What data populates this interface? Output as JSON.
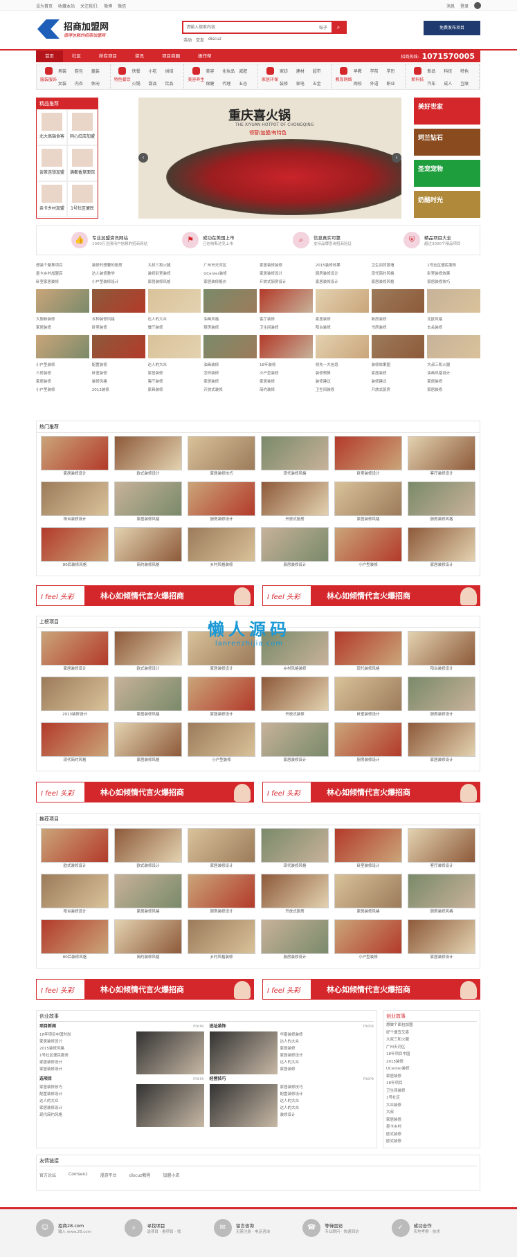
{
  "topbar": {
    "set_home": "设为首页",
    "bookmark": "收藏本站",
    "follow": "关注我们:",
    "weibo": "微博",
    "wechat": "微信",
    "messages": "消息",
    "login": "登录"
  },
  "logo": {
    "name": "招商加盟网",
    "slogan": "值得信赖的招商加盟网"
  },
  "search": {
    "placeholder": "请输入搜索内容",
    "type": "帖子",
    "hot": [
      "活动",
      "交友",
      "discuz"
    ]
  },
  "publish_btn": "免费发布项目",
  "nav": {
    "items": [
      "首页",
      "社区",
      "所有项目",
      "资讯",
      "项目商圈",
      "操作帮"
    ],
    "phone_label": "招商热线:",
    "phone": "1071570005"
  },
  "categories": [
    {
      "main": "服装服饰",
      "subs": [
        "男装",
        "鞋包",
        "童装",
        "女装",
        "内衣",
        "休闲"
      ]
    },
    {
      "main": "特色餐饮",
      "subs": [
        "快餐",
        "小吃",
        "烘焙",
        "火锅",
        "甜品",
        "饮品"
      ]
    },
    {
      "main": "美容养生",
      "subs": [
        "美容",
        "化妆品",
        "减肥",
        "保健",
        "代理",
        "五谷"
      ]
    },
    {
      "main": "家居环保",
      "subs": [
        "家纺",
        "建材",
        "超市",
        "装修",
        "家电",
        "五金"
      ]
    },
    {
      "main": "教育网络",
      "subs": [
        "早教",
        "学前",
        "学历",
        "网校",
        "外语",
        "职业"
      ]
    },
    {
      "main": "新科技",
      "subs": [
        "新品",
        "科技",
        "特色",
        "汽车",
        "成人",
        "互联"
      ]
    }
  ],
  "featured": {
    "title": "精品推荐",
    "items": [
      "北大高端食客",
      "同心红店加盟",
      "谈茶连锁加盟",
      "满都香草面馆",
      "亲卡乡村加盟",
      "1号社区便民"
    ]
  },
  "banner": {
    "title": "重庆喜火锅",
    "subtitle": "THE XIYUAN HOTPOT OF CHONGQING",
    "tag": "领营/加盟/有特色",
    "prev": "‹",
    "next": "›"
  },
  "ads": [
    {
      "t": "美好世家",
      "c": "#d4272c"
    },
    {
      "t": "珂兰钻石",
      "c": "#8a4b1e"
    },
    {
      "t": "圣宠宠物",
      "c": "#1e9e3d"
    },
    {
      "t": "奶酪时光",
      "c": "#b08a3a"
    }
  ],
  "promises": [
    {
      "t1": "专业加盟资讯网站",
      "t2": "1000万注册用户信赖的招商网站",
      "icon": "thumb-icon"
    },
    {
      "t1": "成功在美国上市",
      "t2": "已在纳斯达克上市",
      "icon": "flag-icon"
    },
    {
      "t1": "信息真实可靠",
      "t2": "支持品牌查询招商验证",
      "icon": "search-icon"
    },
    {
      "t1": "精品项目大全",
      "t2": "超过3000个精品项目",
      "icon": "shield-icon"
    }
  ],
  "news_rows1": [
    [
      "想装个聚焦项目",
      "装修时想要的厨房",
      "大叔三和火腿",
      "广州市天河区",
      "家居装修装修",
      "2015装修效果",
      "卫生间背景墙",
      "1号社区便民服务"
    ],
    [
      "墨卡乡村加盟店",
      "达人装修教学",
      "装修卧室装修",
      "UCenter装修",
      "家居装修设计",
      "厨房装修设计",
      "现代简约风格",
      "卧室装修效果"
    ],
    [
      "卧室家居装修",
      "小户型装修设计",
      "家居装修风格",
      "家居装修报价",
      "开放式厨房设计",
      "家居装修设计",
      "家居装修风格",
      "家居装修技巧"
    ]
  ],
  "news_rows2": [
    [
      "大厨新装修",
      "五种装修风格",
      "达人的大众",
      "油画风格",
      "客厅装修",
      "家居装修",
      "新房装修",
      "北欧风格"
    ],
    [
      "家居装修",
      "卧室装修",
      "餐厅装修",
      "厨房装修",
      "卫生间装修",
      "阳台装修",
      "书房装修",
      "玄关装修"
    ]
  ],
  "news_rows3": [
    [
      "小户型装修",
      "配置装修",
      "达人的大众",
      "油画装修",
      "18年装修",
      "领先一大信息",
      "装修效果图",
      "大叔三和火腿"
    ],
    [
      "三房装修",
      "卧室装修",
      "家居装修",
      "怎样装修",
      "小户型装修",
      "装修预算",
      "家居装修",
      "油画风格设计"
    ],
    [
      "家居装修",
      "装修风格",
      "客厅装修",
      "家居装修",
      "家居装修",
      "装修建议",
      "装修建议",
      "家居装修"
    ],
    [
      "小户型装修",
      "2013装修",
      "家具装修",
      "开放式装修",
      "简约装修",
      "卫生间装修",
      "开放式厨房",
      "家居装修"
    ]
  ],
  "sections": [
    {
      "title": "热门推荐",
      "rows": [
        [
          "家居装修设计",
          "欧式装修设计",
          "家居装修技巧",
          "现代装修风格",
          "卧室装修设计",
          "客厅装修设计"
        ],
        [
          "阳台装修设计",
          "家居装修风格",
          "厨房装修设计",
          "开放式厨房",
          "家居装修风格",
          "厨房装修风格"
        ],
        [
          "80后装修风格",
          "简约装修风格",
          "乡村风格装修",
          "厨房装修设计",
          "小户型装修",
          "家居装修设计"
        ]
      ]
    },
    {
      "title": "上榜项目",
      "rows": [
        [
          "家居装修设计",
          "欧式装修设计",
          "家居装修设计",
          "乡村风格装修",
          "现代装修风格",
          "阳台装修设计"
        ],
        [
          "2013装修设计",
          "家居装修风格",
          "家居装修设计",
          "开放式装修",
          "卧室装修设计",
          "厨房装修设计"
        ],
        [
          "现代简约风格",
          "家居装修风格",
          "小户型装修",
          "家居装修设计",
          "厨房装修设计",
          "家居装修设计"
        ]
      ]
    },
    {
      "title": "推荐项目",
      "rows": [
        [
          "欧式装修设计",
          "欧式装修设计",
          "家居装修设计",
          "现代装修风格",
          "卧室装修设计",
          "客厅装修设计"
        ],
        [
          "阳台装修设计",
          "家居装修风格",
          "厨房装修设计",
          "开放式厨房",
          "家居装修风格",
          "厨房装修风格"
        ],
        [
          "80后装修风格",
          "简约装修风格",
          "乡村风格装修",
          "厨房装修设计",
          "小户型装修",
          "家居装修设计"
        ]
      ]
    }
  ],
  "banner_ad": {
    "brand": "I feel",
    "logo": "头彩",
    "text": "林心如倾情代言火爆招商"
  },
  "watermark": {
    "cn": "懒人源码",
    "url": "lanrenzhijia.com"
  },
  "stories": {
    "title": "创业故事",
    "blocks": [
      {
        "title": "项目新闻",
        "more": "more",
        "lines": [
          "18年项目中国时尚",
          "家居装修设计",
          "2015装修风格",
          "1号社区便民服务",
          "家居装修设计",
          "家居装修设计"
        ]
      },
      {
        "title": "选址装饰",
        "more": "more",
        "lines": [
          "华夏装修装修",
          "达人的大众",
          "家居装修",
          "家居装修设计",
          "达人的大众",
          "家居装修"
        ]
      },
      {
        "title": "选项目",
        "more": "more",
        "lines": [
          "家居装修技巧",
          "配置装修设计",
          "达人的大众",
          "家居装修设计",
          "现代简约风格"
        ]
      },
      {
        "title": "经营技巧",
        "more": "more",
        "lines": [
          "家居装修技巧",
          "配置装修设计",
          "达人的大众",
          "达人的大众",
          "装修设计"
        ]
      }
    ],
    "side_title": "创业故事",
    "side_lines": [
      "想做个面包加盟",
      "好个便宜又喜",
      "大叔三和火腿",
      "广州天河区",
      "18年项目中国",
      "2015装修",
      "UCenter装修",
      "家居装修",
      "18年项目",
      "卫生间装修",
      "1号社区",
      "大众装修",
      "大叔",
      "家居装修",
      "墨卡乡村",
      "欧式装修",
      "欧式装修"
    ]
  },
  "friends": {
    "title": "友情链接",
    "links": [
      "官方论坛",
      "Comsenz",
      "漫游平台",
      "discuz教程",
      "加盟小店"
    ]
  },
  "footer": [
    {
      "t1": "招商28.com",
      "t2": "输入 www.28.com",
      "icon": "user-icon"
    },
    {
      "t1": "寻找项目",
      "t2": "选项目 · 看项目 · 找",
      "icon": "search-icon"
    },
    {
      "t1": "留言咨询",
      "t2": "无需注册 · 电话咨询",
      "icon": "chat-icon"
    },
    {
      "t1": "等待回访",
      "t2": "专业顾问 · 快速回访",
      "icon": "phone-icon"
    },
    {
      "t1": "成功合作",
      "t2": "实地考察 · 技术",
      "icon": "handshake-icon"
    }
  ]
}
